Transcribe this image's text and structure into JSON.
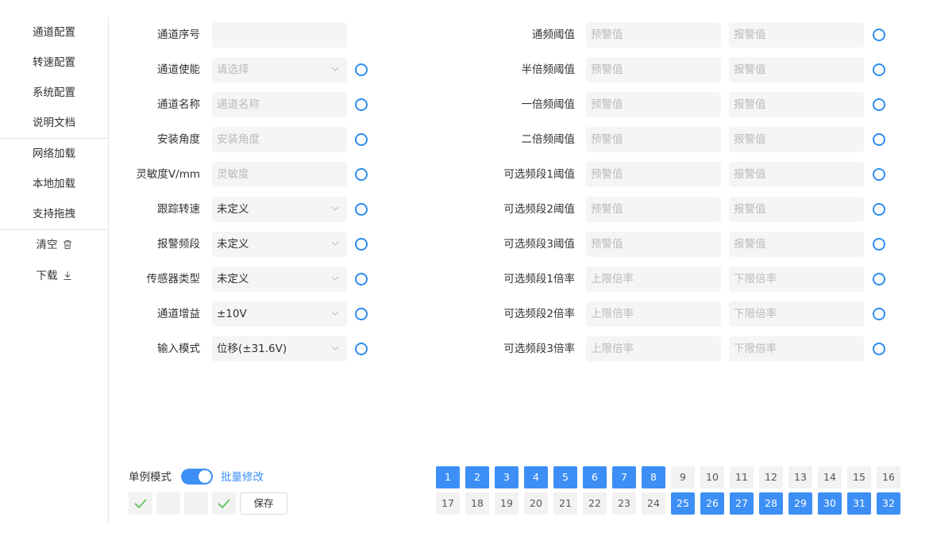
{
  "sidebar": {
    "nav": [
      {
        "label": "通道配置",
        "active": true
      },
      {
        "label": "转速配置",
        "active": false
      },
      {
        "label": "系统配置",
        "active": false
      },
      {
        "label": "说明文档",
        "active": false
      },
      {
        "label": "网络加载",
        "active": false
      },
      {
        "label": "本地加载",
        "active": false
      },
      {
        "label": "支持拖拽",
        "active": false
      }
    ],
    "tools": [
      {
        "label": "清空",
        "icon": "trash-icon"
      },
      {
        "label": "下载",
        "icon": "download-icon"
      }
    ]
  },
  "left_form": [
    {
      "label": "通道序号",
      "value": "",
      "placeholder": "",
      "type": "input",
      "radio": false
    },
    {
      "label": "通道使能",
      "value": "",
      "placeholder": "请选择",
      "type": "select",
      "radio": true
    },
    {
      "label": "通道名称",
      "value": "",
      "placeholder": "通道名称",
      "type": "input",
      "radio": true
    },
    {
      "label": "安装角度",
      "value": "",
      "placeholder": "安装角度",
      "type": "input",
      "radio": true
    },
    {
      "label": "灵敏度V/mm",
      "value": "",
      "placeholder": "灵敏度",
      "type": "input",
      "radio": true
    },
    {
      "label": "跟踪转速",
      "value": "未定义",
      "placeholder": "",
      "type": "select",
      "radio": true
    },
    {
      "label": "报警频段",
      "value": "未定义",
      "placeholder": "",
      "type": "select",
      "radio": true
    },
    {
      "label": "传感器类型",
      "value": "未定义",
      "placeholder": "",
      "type": "select",
      "radio": true
    },
    {
      "label": "通道增益",
      "value": "±10V",
      "placeholder": "",
      "type": "select",
      "radio": true
    },
    {
      "label": "输入模式",
      "value": "位移(±31.6V)",
      "placeholder": "",
      "type": "select",
      "radio": true
    }
  ],
  "right_form": [
    {
      "label": "通频阈值",
      "p1": "预警值",
      "p2": "报警值"
    },
    {
      "label": "半倍频阈值",
      "p1": "预警值",
      "p2": "报警值"
    },
    {
      "label": "一倍频阈值",
      "p1": "预警值",
      "p2": "报警值"
    },
    {
      "label": "二倍频阈值",
      "p1": "预警值",
      "p2": "报警值"
    },
    {
      "label": "可选频段1阈值",
      "p1": "预警值",
      "p2": "报警值"
    },
    {
      "label": "可选频段2阈值",
      "p1": "预警值",
      "p2": "报警值"
    },
    {
      "label": "可选频段3阈值",
      "p1": "预警值",
      "p2": "报警值"
    },
    {
      "label": "可选频段1倍率",
      "p1": "上限倍率",
      "p2": "下限倍率"
    },
    {
      "label": "可选频段2倍率",
      "p1": "上限倍率",
      "p2": "下限倍率"
    },
    {
      "label": "可选频段3倍率",
      "p1": "上限倍率",
      "p2": "下限倍率"
    }
  ],
  "bottom": {
    "single_mode_label": "单例模式",
    "batch_label": "批量修改",
    "toggle_on": true,
    "checks": [
      true,
      false,
      false,
      true
    ],
    "save_label": "保存",
    "accent": "#3d8ff5"
  },
  "channels": [
    {
      "n": "1",
      "on": true
    },
    {
      "n": "2",
      "on": true
    },
    {
      "n": "3",
      "on": true
    },
    {
      "n": "4",
      "on": true
    },
    {
      "n": "5",
      "on": true
    },
    {
      "n": "6",
      "on": true
    },
    {
      "n": "7",
      "on": true
    },
    {
      "n": "8",
      "on": true
    },
    {
      "n": "9",
      "on": false
    },
    {
      "n": "10",
      "on": false
    },
    {
      "n": "11",
      "on": false
    },
    {
      "n": "12",
      "on": false
    },
    {
      "n": "13",
      "on": false
    },
    {
      "n": "14",
      "on": false
    },
    {
      "n": "15",
      "on": false
    },
    {
      "n": "16",
      "on": false
    },
    {
      "n": "17",
      "on": false
    },
    {
      "n": "18",
      "on": false
    },
    {
      "n": "19",
      "on": false
    },
    {
      "n": "20",
      "on": false
    },
    {
      "n": "21",
      "on": false
    },
    {
      "n": "22",
      "on": false
    },
    {
      "n": "23",
      "on": false
    },
    {
      "n": "24",
      "on": false
    },
    {
      "n": "25",
      "on": true
    },
    {
      "n": "26",
      "on": true
    },
    {
      "n": "27",
      "on": true
    },
    {
      "n": "28",
      "on": true
    },
    {
      "n": "29",
      "on": true
    },
    {
      "n": "30",
      "on": true
    },
    {
      "n": "31",
      "on": true
    },
    {
      "n": "32",
      "on": true
    }
  ]
}
